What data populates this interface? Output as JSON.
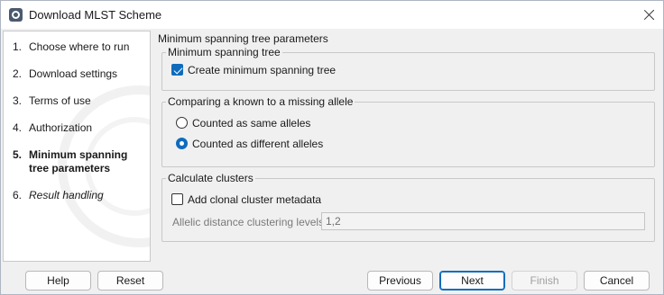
{
  "window": {
    "title": "Download MLST Scheme"
  },
  "steps": [
    {
      "num": "1.",
      "label": "Choose where to run"
    },
    {
      "num": "2.",
      "label": "Download settings"
    },
    {
      "num": "3.",
      "label": "Terms of use"
    },
    {
      "num": "4.",
      "label": "Authorization"
    },
    {
      "num": "5.",
      "label": "Minimum spanning tree parameters"
    },
    {
      "num": "6.",
      "label": "Result handling"
    }
  ],
  "content": {
    "title": "Minimum spanning tree parameters",
    "mst_group": {
      "legend": "Minimum spanning tree",
      "create_label": "Create minimum spanning tree",
      "create_checked": true
    },
    "allele_group": {
      "legend": "Comparing a known to a missing allele",
      "option_same": "Counted as same alleles",
      "option_different": "Counted as different alleles",
      "selected": "different"
    },
    "cluster_group": {
      "legend": "Calculate clusters",
      "clonal_label": "Add clonal cluster metadata",
      "clonal_checked": false,
      "levels_label": "Allelic distance clustering levels",
      "levels_value": "1,2"
    }
  },
  "footer": {
    "help": "Help",
    "reset": "Reset",
    "previous": "Previous",
    "next": "Next",
    "finish": "Finish",
    "cancel": "Cancel"
  },
  "colors": {
    "accent": "#0f6cbd"
  }
}
